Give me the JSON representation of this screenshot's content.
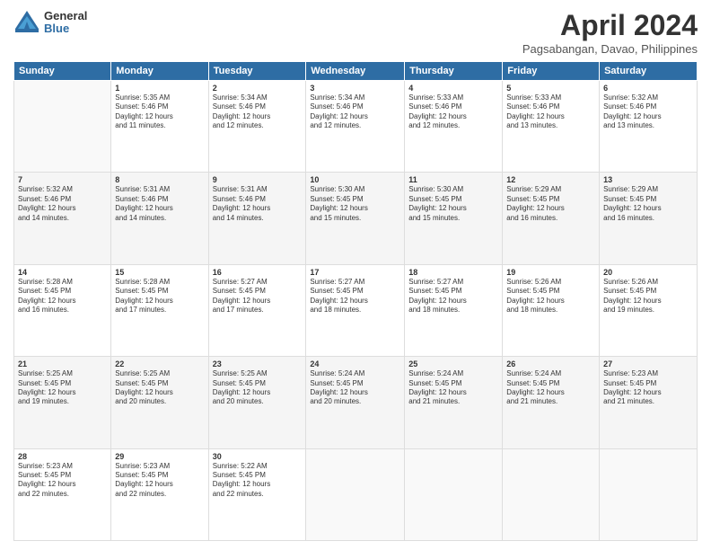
{
  "logo": {
    "general": "General",
    "blue": "Blue"
  },
  "header": {
    "title": "April 2024",
    "location": "Pagsabangan, Davao, Philippines"
  },
  "weekdays": [
    "Sunday",
    "Monday",
    "Tuesday",
    "Wednesday",
    "Thursday",
    "Friday",
    "Saturday"
  ],
  "weeks": [
    [
      {
        "day": "",
        "info": ""
      },
      {
        "day": "1",
        "info": "Sunrise: 5:35 AM\nSunset: 5:46 PM\nDaylight: 12 hours\nand 11 minutes."
      },
      {
        "day": "2",
        "info": "Sunrise: 5:34 AM\nSunset: 5:46 PM\nDaylight: 12 hours\nand 12 minutes."
      },
      {
        "day": "3",
        "info": "Sunrise: 5:34 AM\nSunset: 5:46 PM\nDaylight: 12 hours\nand 12 minutes."
      },
      {
        "day": "4",
        "info": "Sunrise: 5:33 AM\nSunset: 5:46 PM\nDaylight: 12 hours\nand 12 minutes."
      },
      {
        "day": "5",
        "info": "Sunrise: 5:33 AM\nSunset: 5:46 PM\nDaylight: 12 hours\nand 13 minutes."
      },
      {
        "day": "6",
        "info": "Sunrise: 5:32 AM\nSunset: 5:46 PM\nDaylight: 12 hours\nand 13 minutes."
      }
    ],
    [
      {
        "day": "7",
        "info": "Sunrise: 5:32 AM\nSunset: 5:46 PM\nDaylight: 12 hours\nand 14 minutes."
      },
      {
        "day": "8",
        "info": "Sunrise: 5:31 AM\nSunset: 5:46 PM\nDaylight: 12 hours\nand 14 minutes."
      },
      {
        "day": "9",
        "info": "Sunrise: 5:31 AM\nSunset: 5:46 PM\nDaylight: 12 hours\nand 14 minutes."
      },
      {
        "day": "10",
        "info": "Sunrise: 5:30 AM\nSunset: 5:45 PM\nDaylight: 12 hours\nand 15 minutes."
      },
      {
        "day": "11",
        "info": "Sunrise: 5:30 AM\nSunset: 5:45 PM\nDaylight: 12 hours\nand 15 minutes."
      },
      {
        "day": "12",
        "info": "Sunrise: 5:29 AM\nSunset: 5:45 PM\nDaylight: 12 hours\nand 16 minutes."
      },
      {
        "day": "13",
        "info": "Sunrise: 5:29 AM\nSunset: 5:45 PM\nDaylight: 12 hours\nand 16 minutes."
      }
    ],
    [
      {
        "day": "14",
        "info": "Sunrise: 5:28 AM\nSunset: 5:45 PM\nDaylight: 12 hours\nand 16 minutes."
      },
      {
        "day": "15",
        "info": "Sunrise: 5:28 AM\nSunset: 5:45 PM\nDaylight: 12 hours\nand 17 minutes."
      },
      {
        "day": "16",
        "info": "Sunrise: 5:27 AM\nSunset: 5:45 PM\nDaylight: 12 hours\nand 17 minutes."
      },
      {
        "day": "17",
        "info": "Sunrise: 5:27 AM\nSunset: 5:45 PM\nDaylight: 12 hours\nand 18 minutes."
      },
      {
        "day": "18",
        "info": "Sunrise: 5:27 AM\nSunset: 5:45 PM\nDaylight: 12 hours\nand 18 minutes."
      },
      {
        "day": "19",
        "info": "Sunrise: 5:26 AM\nSunset: 5:45 PM\nDaylight: 12 hours\nand 18 minutes."
      },
      {
        "day": "20",
        "info": "Sunrise: 5:26 AM\nSunset: 5:45 PM\nDaylight: 12 hours\nand 19 minutes."
      }
    ],
    [
      {
        "day": "21",
        "info": "Sunrise: 5:25 AM\nSunset: 5:45 PM\nDaylight: 12 hours\nand 19 minutes."
      },
      {
        "day": "22",
        "info": "Sunrise: 5:25 AM\nSunset: 5:45 PM\nDaylight: 12 hours\nand 20 minutes."
      },
      {
        "day": "23",
        "info": "Sunrise: 5:25 AM\nSunset: 5:45 PM\nDaylight: 12 hours\nand 20 minutes."
      },
      {
        "day": "24",
        "info": "Sunrise: 5:24 AM\nSunset: 5:45 PM\nDaylight: 12 hours\nand 20 minutes."
      },
      {
        "day": "25",
        "info": "Sunrise: 5:24 AM\nSunset: 5:45 PM\nDaylight: 12 hours\nand 21 minutes."
      },
      {
        "day": "26",
        "info": "Sunrise: 5:24 AM\nSunset: 5:45 PM\nDaylight: 12 hours\nand 21 minutes."
      },
      {
        "day": "27",
        "info": "Sunrise: 5:23 AM\nSunset: 5:45 PM\nDaylight: 12 hours\nand 21 minutes."
      }
    ],
    [
      {
        "day": "28",
        "info": "Sunrise: 5:23 AM\nSunset: 5:45 PM\nDaylight: 12 hours\nand 22 minutes."
      },
      {
        "day": "29",
        "info": "Sunrise: 5:23 AM\nSunset: 5:45 PM\nDaylight: 12 hours\nand 22 minutes."
      },
      {
        "day": "30",
        "info": "Sunrise: 5:22 AM\nSunset: 5:45 PM\nDaylight: 12 hours\nand 22 minutes."
      },
      {
        "day": "",
        "info": ""
      },
      {
        "day": "",
        "info": ""
      },
      {
        "day": "",
        "info": ""
      },
      {
        "day": "",
        "info": ""
      }
    ]
  ]
}
